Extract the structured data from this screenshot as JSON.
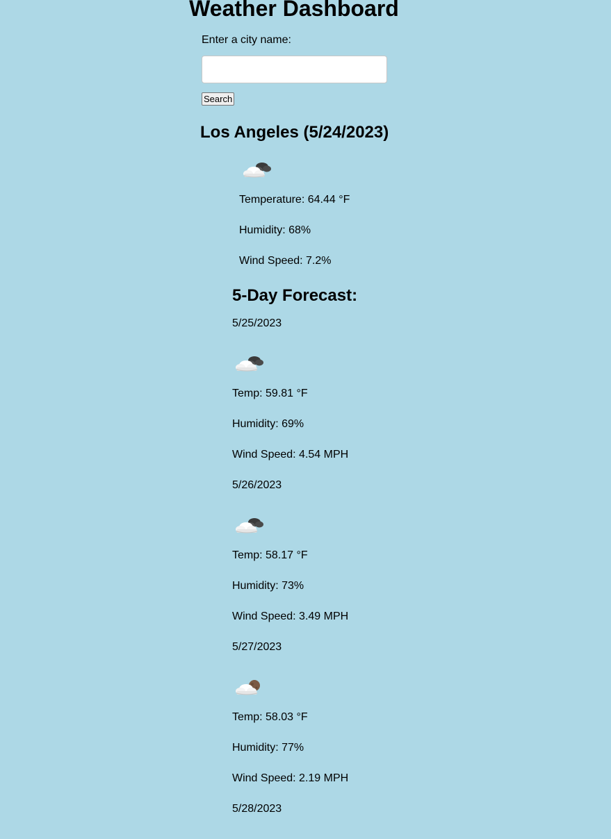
{
  "page": {
    "title": "Weather Dashboard"
  },
  "search": {
    "label": "Enter a city name:",
    "value": "",
    "placeholder": "",
    "button_label": "Search"
  },
  "current": {
    "heading": "Los Angeles (5/24/2023)",
    "icon": "cloudy-night-icon",
    "temperature": "Temperature: 64.44 °F",
    "humidity": "Humidity: 68%",
    "wind": "Wind Speed: 7.2%"
  },
  "forecast": {
    "heading": "5-Day Forecast:",
    "days": [
      {
        "date": "5/25/2023",
        "icon": "cloudy-night-icon",
        "temp": "Temp: 59.81 °F",
        "humidity": "Humidity: 69%",
        "wind": "Wind Speed: 4.54 MPH"
      },
      {
        "date": "5/26/2023",
        "icon": "cloudy-night-icon",
        "temp": "Temp: 58.17 °F",
        "humidity": "Humidity: 73%",
        "wind": "Wind Speed: 3.49 MPH"
      },
      {
        "date": "5/27/2023",
        "icon": "partly-cloudy-night-icon",
        "temp": "Temp: 58.03 °F",
        "humidity": "Humidity: 77%",
        "wind": "Wind Speed: 2.19 MPH"
      },
      {
        "date": "5/28/2023"
      }
    ]
  }
}
